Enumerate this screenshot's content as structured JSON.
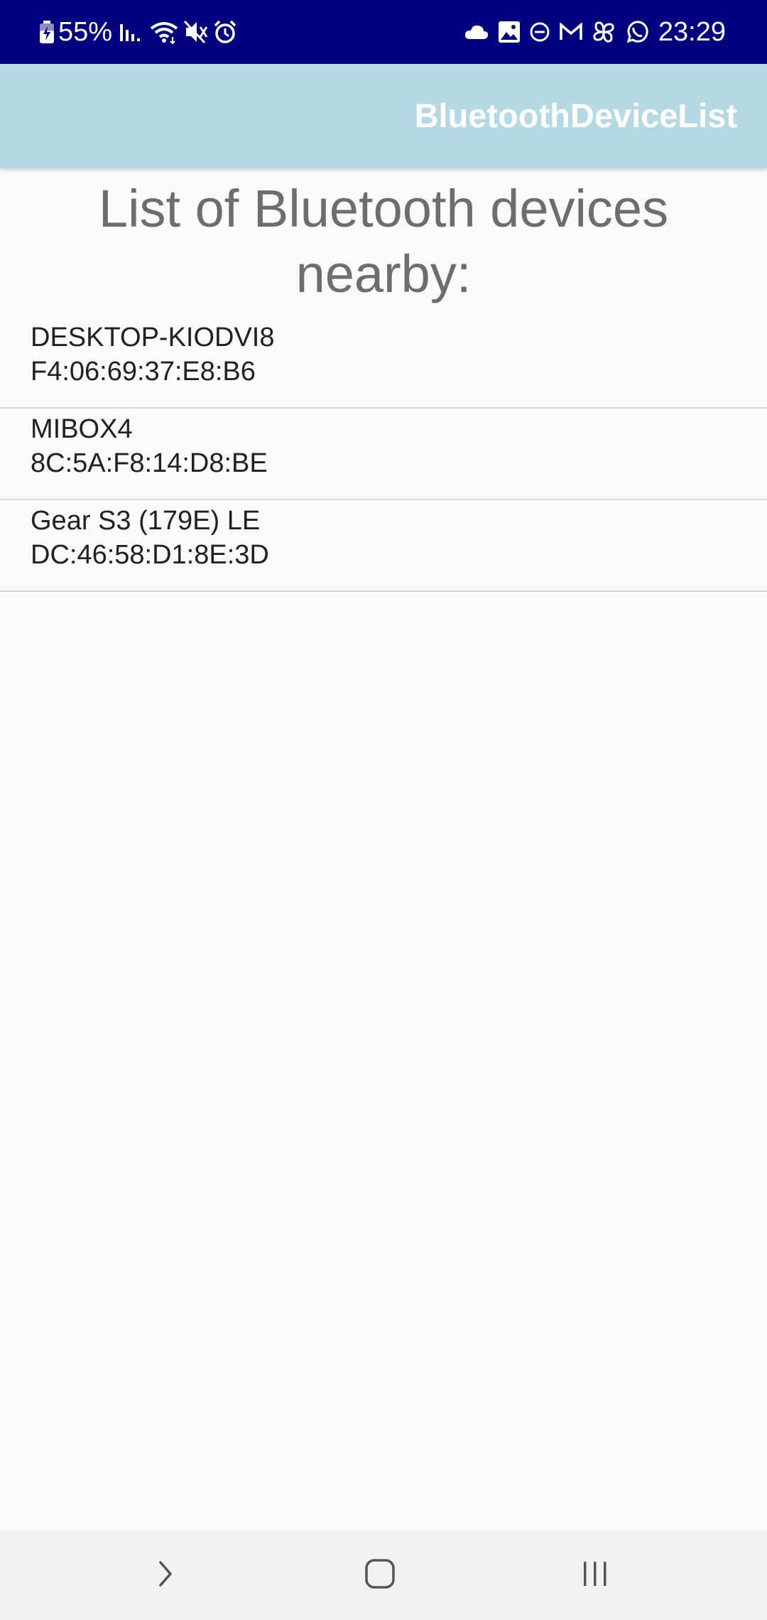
{
  "status_bar": {
    "battery": "55%",
    "time": "23:29",
    "left_icons": [
      "battery-charging-icon",
      "signal-icon",
      "wifi-icon",
      "mute-icon",
      "alarm-icon"
    ],
    "right_icons": [
      "cloud-icon",
      "gallery-icon",
      "do-not-disturb-icon",
      "gmail-icon",
      "pinwheel-icon",
      "whatsapp-icon"
    ]
  },
  "app_bar": {
    "title": "BluetoothDeviceList"
  },
  "main": {
    "heading": "List of Bluetooth devices nearby:",
    "devices": [
      {
        "name": "DESKTOP-KIODVI8",
        "address": "F4:06:69:37:E8:B6"
      },
      {
        "name": "MIBOX4",
        "address": "8C:5A:F8:14:D8:BE"
      },
      {
        "name": "Gear S3 (179E) LE",
        "address": "DC:46:58:D1:8E:3D"
      }
    ]
  },
  "nav_bar": {
    "buttons": [
      "back-icon",
      "home-icon",
      "recents-icon"
    ]
  },
  "colors": {
    "status_bar": "#000080",
    "app_bar": "#b4d9e5",
    "heading_text": "#6d6d6d",
    "divider": "#d6d6d6",
    "background": "#fafafa",
    "nav_bar": "#f1f1f1"
  }
}
